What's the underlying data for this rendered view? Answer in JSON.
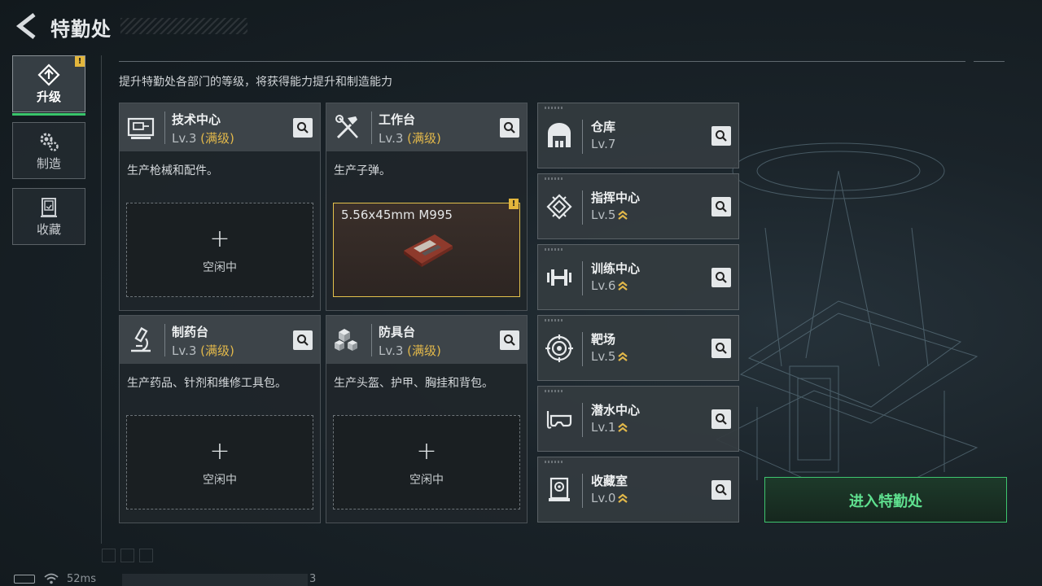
{
  "header": {
    "title": "特勤处",
    "subtitle": "提升特勤处各部门的等级，将获得能力提升和制造能力"
  },
  "tabs": [
    {
      "label": "升级",
      "icon": "upgrade-icon",
      "active": true,
      "badge": "!"
    },
    {
      "label": "制造",
      "icon": "gears-icon",
      "active": false
    },
    {
      "label": "收藏",
      "icon": "collection-icon",
      "active": false
    }
  ],
  "workshops": [
    {
      "name": "技术中心",
      "level": "Lv.3",
      "max": "(满级)",
      "desc": "生产枪械和配件。",
      "slot_plus": "+",
      "slot_text": "空闲中",
      "icon": "computer-icon"
    },
    {
      "name": "工作台",
      "level": "Lv.3",
      "max": "(满级)",
      "desc": "生产子弹。",
      "slot_item": "5.56x45mm M995",
      "badge": "!",
      "icon": "tools-icon"
    },
    {
      "name": "制药台",
      "level": "Lv.3",
      "max": "(满级)",
      "desc": "生产药品、针剂和维修工具包。",
      "slot_plus": "+",
      "slot_text": "空闲中",
      "icon": "microscope-icon"
    },
    {
      "name": "防具台",
      "level": "Lv.3",
      "max": "(满级)",
      "desc": "生产头盔、护甲、胸挂和背包。",
      "slot_plus": "+",
      "slot_text": "空闲中",
      "icon": "armor-cubes-icon"
    }
  ],
  "facilities": [
    {
      "name": "仓库",
      "level": "Lv.7",
      "upgradable": false,
      "icon": "warehouse-icon"
    },
    {
      "name": "指挥中心",
      "level": "Lv.5",
      "upgradable": true,
      "icon": "chip-icon"
    },
    {
      "name": "训练中心",
      "level": "Lv.6",
      "upgradable": true,
      "icon": "dumbbell-icon"
    },
    {
      "name": "靶场",
      "level": "Lv.5",
      "upgradable": true,
      "icon": "target-icon"
    },
    {
      "name": "潜水中心",
      "level": "Lv.1",
      "upgradable": true,
      "icon": "diving-mask-icon"
    },
    {
      "name": "收藏室",
      "level": "Lv.0",
      "upgradable": true,
      "icon": "display-case-icon"
    }
  ],
  "enter_button": "进入特勤处",
  "status": {
    "ping": "52ms",
    "trail": "3"
  },
  "colors": {
    "accent_green": "#3ec56e",
    "max_level_gold": "#e2b84a",
    "warning_yellow": "#e3b63c"
  }
}
